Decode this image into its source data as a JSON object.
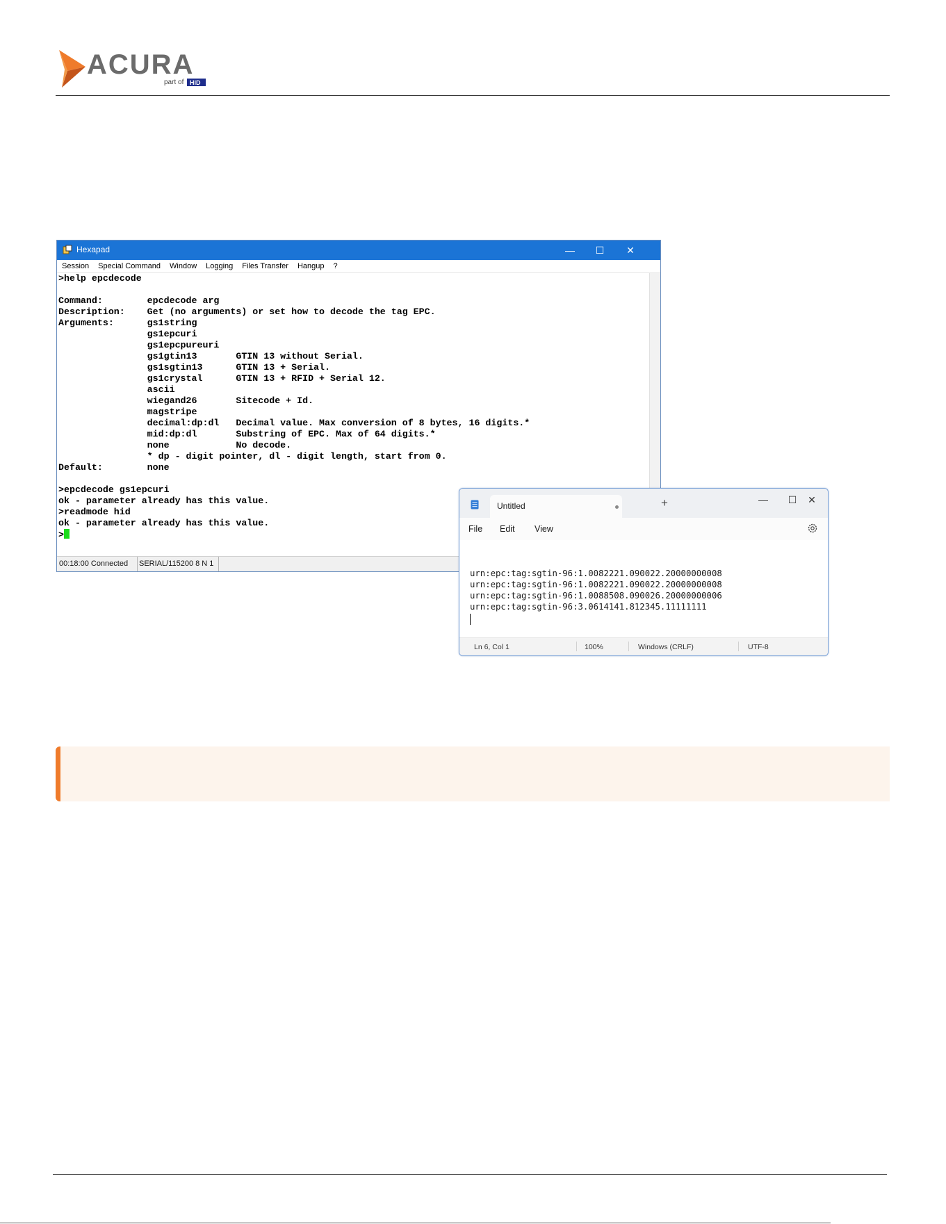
{
  "brand": {
    "logo_name": "ACURA",
    "logo_subtext": "part of",
    "logo_partner": "HID",
    "accent_color": "#ef7b2b"
  },
  "hexapad": {
    "title": "Hexapad",
    "menu": [
      "Session",
      "Special Command",
      "Window",
      "Logging",
      "Files Transfer",
      "Hangup",
      "?"
    ],
    "lines": [
      ">help epcdecode",
      "",
      "Command:        epcdecode arg",
      "Description:    Get (no arguments) or set how to decode the tag EPC.",
      "Arguments:      gs1string",
      "                gs1epcuri",
      "                gs1epcpureuri",
      "                gs1gtin13       GTIN 13 without Serial.",
      "                gs1sgtin13      GTIN 13 + Serial.",
      "                gs1crystal      GTIN 13 + RFID + Serial 12.",
      "                ascii",
      "                wiegand26       Sitecode + Id.",
      "                magstripe",
      "                decimal:dp:dl   Decimal value. Max conversion of 8 bytes, 16 digits.*",
      "                mid:dp:dl       Substring of EPC. Max of 64 digits.*",
      "                none            No decode.",
      "                * dp - digit pointer, dl - digit length, start from 0.",
      "Default:        none",
      "",
      ">epcdecode gs1epcuri",
      "ok - parameter already has this value.",
      ">readmode hid",
      "ok - parameter already has this value."
    ],
    "prompt": ">",
    "status": {
      "time": "00:18:00 Connected",
      "port": "SERIAL/115200 8 N 1"
    },
    "controls": {
      "minimize": "—",
      "maximize": "☐",
      "close": "✕"
    }
  },
  "notepad": {
    "tab_title": "Untitled",
    "new_tab": "+",
    "menu": [
      "File",
      "Edit",
      "View"
    ],
    "lines": [
      "urn:epc:tag:sgtin-96:1.0082221.090022.20000000008",
      "urn:epc:tag:sgtin-96:1.0082221.090022.20000000008",
      "urn:epc:tag:sgtin-96:1.0088508.090026.20000000006",
      "urn:epc:tag:sgtin-96:3.0614141.812345.11111111"
    ],
    "status": {
      "position": "Ln 6, Col 1",
      "zoom": "100%",
      "line_ending": "Windows (CRLF)",
      "encoding": "UTF-8"
    },
    "controls": {
      "minimize": "—",
      "maximize": "☐",
      "close": "✕"
    }
  }
}
